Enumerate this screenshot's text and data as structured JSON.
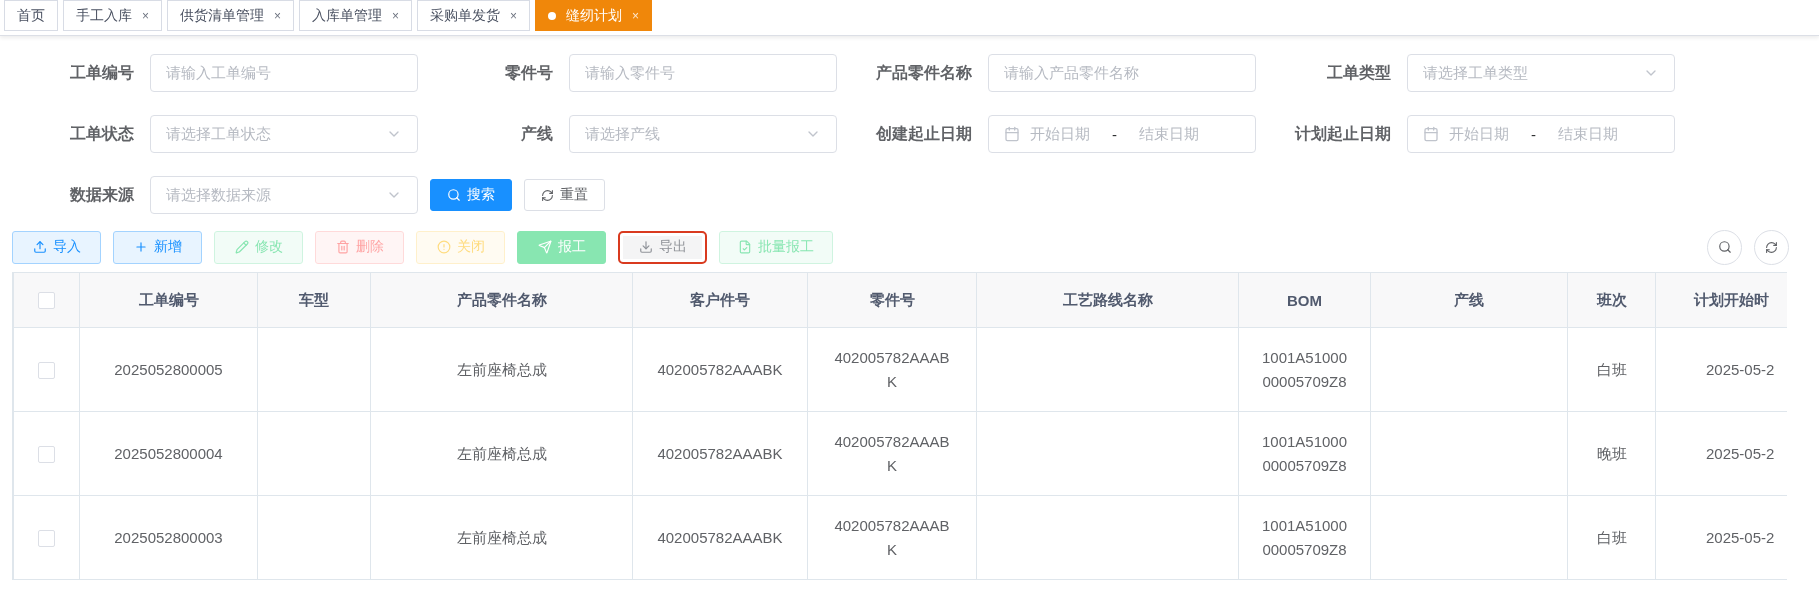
{
  "tabs": [
    {
      "label": "首页",
      "selected": false
    },
    {
      "label": "手工入库",
      "close": "×",
      "selected": false
    },
    {
      "label": "供货清单管理",
      "close": "×",
      "selected": false
    },
    {
      "label": "入库单管理",
      "close": "×",
      "selected": false
    },
    {
      "label": "采购单发货",
      "close": "×",
      "selected": false
    },
    {
      "label": "缝纫计划",
      "close": "×",
      "selected": true
    }
  ],
  "filters": [
    {
      "label": "工单编号",
      "kind": "input",
      "placeholder": "请输入工单编号"
    },
    {
      "label": "零件号",
      "kind": "input",
      "placeholder": "请输入零件号"
    },
    {
      "label": "产品零件名称",
      "kind": "input",
      "placeholder": "请输入产品零件名称"
    },
    {
      "label": "工单类型",
      "kind": "select",
      "placeholder": "请选择工单类型"
    },
    {
      "label": "工单状态",
      "kind": "select",
      "placeholder": "请选择工单状态"
    },
    {
      "label": "产线",
      "kind": "select",
      "placeholder": "请选择产线"
    },
    {
      "label": "创建起止日期",
      "kind": "daterange",
      "start_placeholder": "开始日期",
      "separator": "-",
      "end_placeholder": "结束日期"
    },
    {
      "label": "计划起止日期",
      "kind": "daterange",
      "start_placeholder": "开始日期",
      "separator": "-",
      "end_placeholder": "结束日期"
    },
    {
      "label": "数据来源",
      "kind": "select",
      "placeholder": "请选择数据来源"
    }
  ],
  "search_button": "搜索",
  "reset_button": "重置",
  "toolbar": [
    {
      "label": "导入",
      "disabled": false,
      "highlighted": false
    },
    {
      "label": "新增",
      "disabled": false,
      "highlighted": false
    },
    {
      "label": "修改",
      "disabled": true,
      "highlighted": false
    },
    {
      "label": "删除",
      "disabled": true,
      "highlighted": false
    },
    {
      "label": "关闭",
      "disabled": true,
      "highlighted": false
    },
    {
      "label": "报工",
      "disabled": true,
      "highlighted": false
    },
    {
      "label": "导出",
      "disabled": false,
      "highlighted": true
    },
    {
      "label": "批量报工",
      "disabled": true,
      "highlighted": false
    }
  ],
  "table": {
    "all_checked": false,
    "columns": [
      "工单编号",
      "车型",
      "产品零件名称",
      "客户件号",
      "零件号",
      "工艺路线名称",
      "BOM",
      "产线",
      "班次",
      "计划开始时"
    ],
    "rows": [
      {
        "checked": false,
        "cells": [
          "2025052800005",
          "",
          "左前座椅总成",
          "402005782AAABK",
          "402005782AAABK",
          "",
          "1001A5100000005709Z8",
          "",
          "白班",
          "2025-05-2"
        ]
      },
      {
        "checked": false,
        "cells": [
          "2025052800004",
          "",
          "左前座椅总成",
          "402005782AAABK",
          "402005782AAABK",
          "",
          "1001A5100000005709Z8",
          "",
          "晚班",
          "2025-05-2"
        ]
      },
      {
        "checked": false,
        "cells": [
          "2025052800003",
          "",
          "左前座椅总成",
          "402005782AAABK",
          "402005782AAABK",
          "",
          "1001A5100000005709Z8",
          "",
          "白班",
          "2025-05-2"
        ]
      }
    ]
  }
}
